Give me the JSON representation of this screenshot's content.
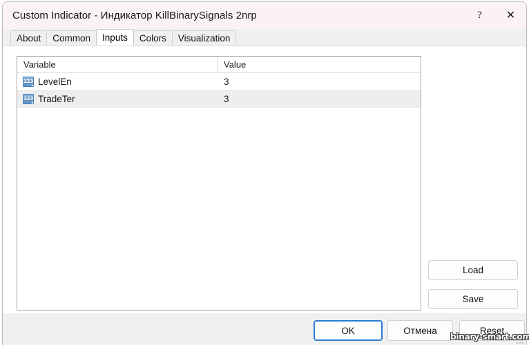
{
  "window": {
    "title": "Custom Indicator - Индикатор KillBinarySignals 2nrp",
    "help_glyph": "?",
    "close_glyph": "✕",
    "accent_color": "#2b7cd3",
    "titlebar_color": "#faf2f4"
  },
  "tabs": [
    {
      "label": "About",
      "active": false
    },
    {
      "label": "Common",
      "active": false
    },
    {
      "label": "Inputs",
      "active": true
    },
    {
      "label": "Colors",
      "active": false
    },
    {
      "label": "Visualization",
      "active": false
    }
  ],
  "inputs_table": {
    "columns": [
      "Variable",
      "Value"
    ],
    "rows": [
      {
        "icon": "numeric-type-icon",
        "icon_glyph": "123",
        "variable": "LevelEn",
        "value": "3"
      },
      {
        "icon": "numeric-type-icon",
        "icon_glyph": "123",
        "variable": "TradeTer",
        "value": "3"
      }
    ]
  },
  "side_buttons": {
    "load_label": "Load",
    "save_label": "Save"
  },
  "footer_buttons": {
    "ok_label": "OK",
    "cancel_label": "Отмена",
    "reset_label": "Reset"
  },
  "watermark": {
    "text": "binary-smart.com"
  }
}
